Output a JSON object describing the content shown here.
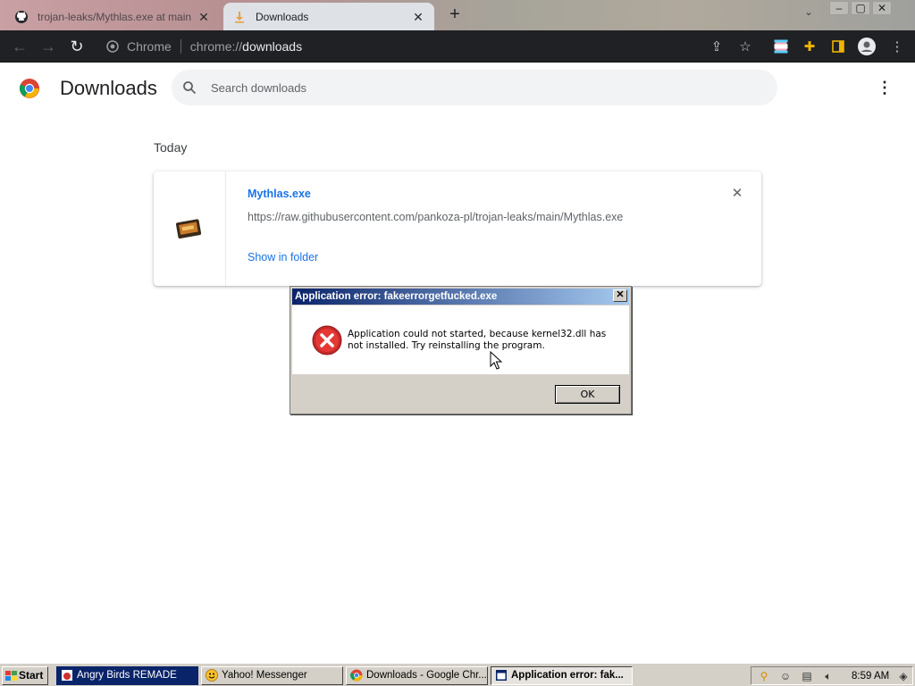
{
  "browser": {
    "tabs": [
      {
        "title": "trojan-leaks/Mythlas.exe at main",
        "active": false,
        "icon": "github-icon"
      },
      {
        "title": "Downloads",
        "active": true,
        "icon": "download-icon"
      }
    ],
    "omnibox": {
      "site_label": "Chrome",
      "scheme": "chrome://",
      "path": "downloads"
    }
  },
  "page": {
    "title": "Downloads",
    "search_placeholder": "Search downloads",
    "section_label": "Today",
    "download": {
      "file_name": "Mythlas.exe",
      "url": "https://raw.githubusercontent.com/pankoza-pl/trojan-leaks/main/Mythlas.exe",
      "action_label": "Show in folder"
    }
  },
  "dialog": {
    "title": "Application error: fakeerrorgetfucked.exe",
    "message": "Application could not started, because kernel32.dll has not installed. Try reinstalling the program.",
    "ok_label": "OK",
    "icon": "error-icon"
  },
  "taskbar": {
    "start_label": "Start",
    "tasks": [
      {
        "label": "Angry Birds REMADE",
        "icon": "angry-birds-icon"
      },
      {
        "label": "Yahoo! Messenger",
        "icon": "yahoo-messenger-icon"
      },
      {
        "label": "Downloads - Google Chr...",
        "icon": "chrome-icon"
      },
      {
        "label": "Application error: fak...",
        "icon": "app-error-icon"
      }
    ],
    "clock": "8:59 AM"
  },
  "colors": {
    "link_blue": "#1a73e8",
    "chrome_dark": "#202124",
    "win_face": "#d4d0c8",
    "title_bar_start": "#0a246a",
    "title_bar_end": "#a6caf0"
  }
}
